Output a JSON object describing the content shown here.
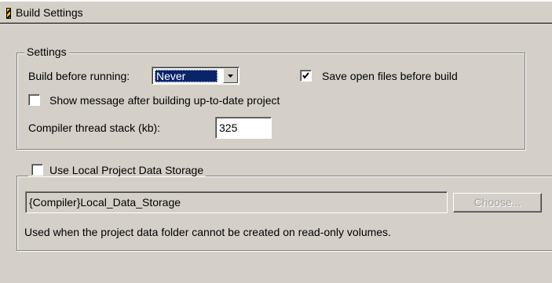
{
  "window": {
    "title": "Build Settings",
    "title_icon": "build-hatch-icon"
  },
  "settings_group": {
    "legend": "Settings",
    "build_before_running": {
      "label": "Build before running:",
      "selected": "Never"
    },
    "save_open_files": {
      "label": "Save open files before build",
      "checked": true
    },
    "show_message": {
      "label": "Show message after building up-to-date project",
      "checked": false
    },
    "compiler_stack": {
      "label": "Compiler thread stack (kb):",
      "value": "325"
    }
  },
  "local_storage_group": {
    "legend": "Use Local Project Data Storage",
    "checked": false,
    "path_value": "{Compiler}Local_Data_Storage",
    "choose_label": "Choose...",
    "description": "Used when the project data folder cannot be created on read-only volumes."
  },
  "colors": {
    "background": "#d4d0c8",
    "selection": "#0a246a",
    "hatch": "#f5c400"
  }
}
